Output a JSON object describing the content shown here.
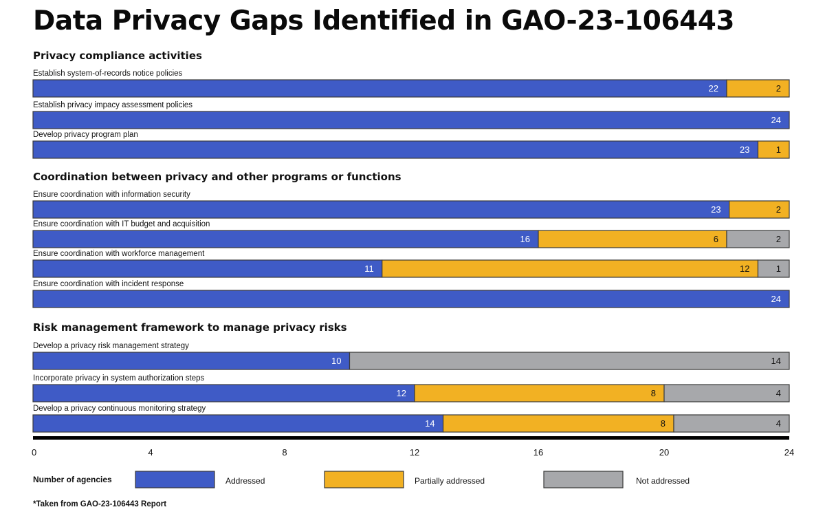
{
  "chart_data": {
    "type": "bar",
    "orientation": "horizontal-stacked",
    "title": "Data Privacy Gaps Identified in GAO-23-106443",
    "xlabel": "Number of agencies",
    "xlim": [
      0,
      24
    ],
    "xticks": [
      0,
      4,
      8,
      12,
      16,
      20,
      24
    ],
    "grid": false,
    "legend_placement": "bottom",
    "series_names": [
      "Addressed",
      "Partially addressed",
      "Not addressed"
    ],
    "colors": {
      "Addressed": "#3f5bc6",
      "Partially addressed": "#f2b123",
      "Not addressed": "#a7a8ab"
    },
    "label_colors": {
      "Addressed": "#ffffff",
      "Partially addressed": "#111111",
      "Not addressed": "#111111"
    },
    "groups": [
      {
        "title": "Privacy compliance activities",
        "rows": [
          {
            "label": "Establish system-of-records notice policies",
            "values": [
              22,
              2,
              0
            ]
          },
          {
            "label": "Establish privacy impacy assessment policies",
            "values": [
              24,
              0,
              0
            ]
          },
          {
            "label": "Develop privacy program plan",
            "values": [
              23,
              1,
              0
            ]
          }
        ]
      },
      {
        "title": "Coordination between privacy and other programs or functions",
        "rows": [
          {
            "label": "Ensure coordination with information security",
            "values": [
              23,
              2,
              0
            ]
          },
          {
            "label": "Ensure coordination with IT budget and acquisition",
            "values": [
              16,
              6,
              2
            ]
          },
          {
            "label": "Ensure coordination with workforce management",
            "values": [
              11,
              12,
              1
            ]
          },
          {
            "label": "Ensure coordination with incident response",
            "values": [
              24,
              0,
              0
            ]
          }
        ]
      },
      {
        "title": "Risk management framework to manage privacy risks",
        "rows": [
          {
            "label": "Develop a privacy risk management strategy",
            "values": [
              10,
              0,
              14
            ]
          },
          {
            "label": "Incorporate privacy in system authorization steps",
            "values": [
              12,
              8,
              4
            ]
          },
          {
            "label": "Develop a privacy continuous monitoring strategy",
            "values": [
              14,
              8,
              4
            ]
          }
        ]
      }
    ],
    "legend": {
      "title": "Number of agencies",
      "items": [
        "Addressed",
        "Partially addressed",
        "Not addressed"
      ]
    },
    "footnote": "*Taken from GAO-23-106443 Report"
  }
}
